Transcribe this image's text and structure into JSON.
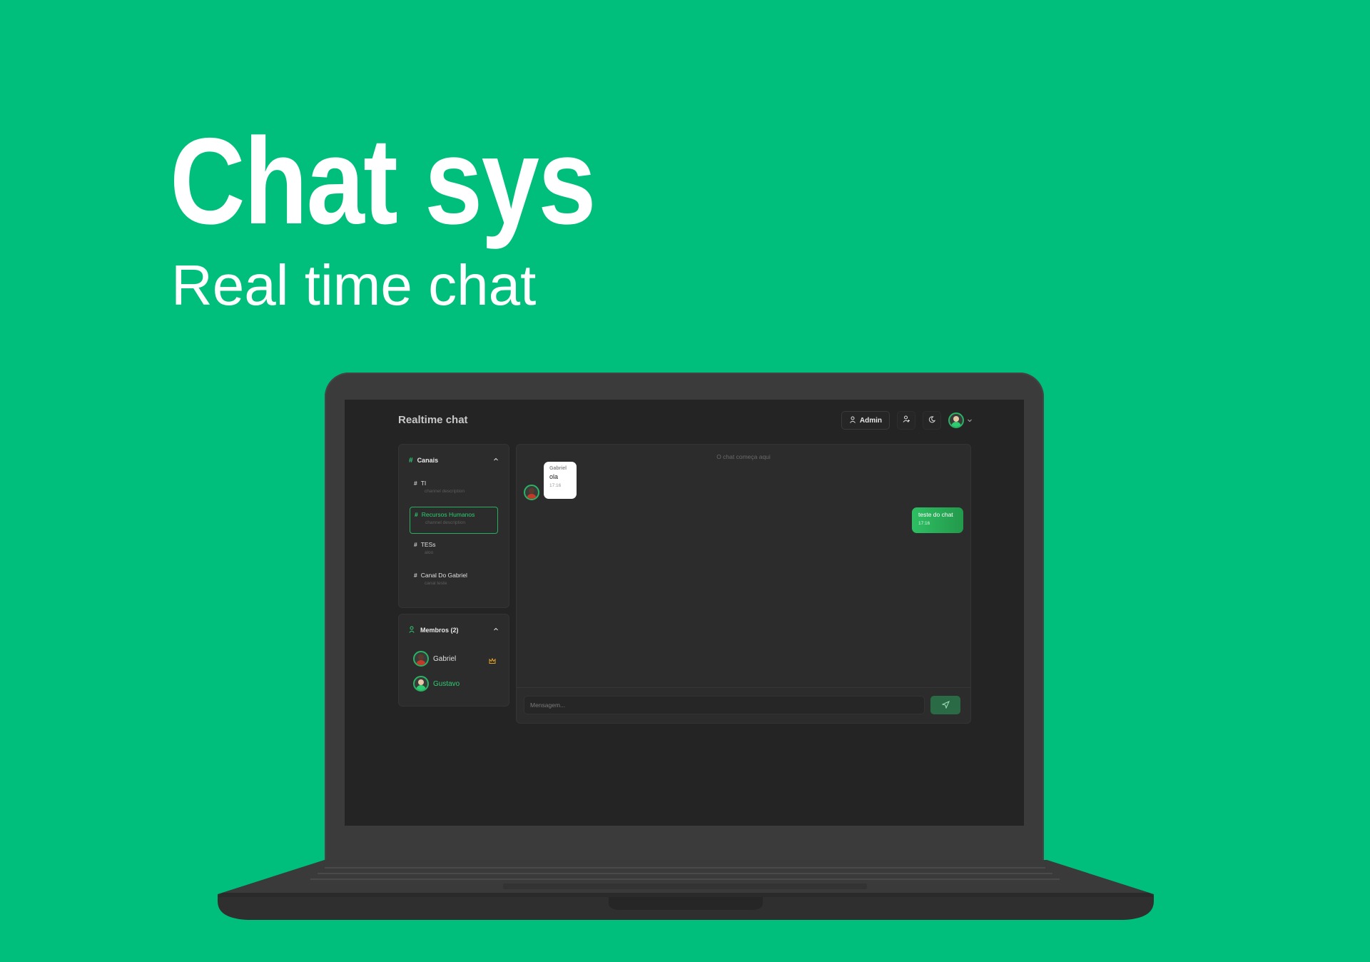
{
  "hero": {
    "title": "Chat sys",
    "subtitle": "Real time chat"
  },
  "app": {
    "title": "Realtime chat",
    "admin_label": "Admin",
    "colors": {
      "accent": "#2ecc71",
      "background": "#00bf7d",
      "screen": "#242424"
    }
  },
  "channels": {
    "header": "Canais",
    "items": [
      {
        "name": "TI",
        "description": "channel description",
        "active": false
      },
      {
        "name": "Recursos Humanos",
        "description": "channel description",
        "active": true
      },
      {
        "name": "TESs",
        "description": "aloo",
        "active": false
      },
      {
        "name": "Canal Do Gabriel",
        "description": "canal teste",
        "active": false
      }
    ]
  },
  "members": {
    "header": "Membros (2)",
    "items": [
      {
        "name": "Gabriel",
        "role_icon": "crown-icon"
      },
      {
        "name": "Gustavo"
      }
    ]
  },
  "chat": {
    "start_label": "O chat começa aqui",
    "messages": [
      {
        "sender": "Gabriel",
        "text": "ola",
        "time": "17:16",
        "direction": "incoming"
      },
      {
        "text": "teste do chat",
        "time": "17:16",
        "direction": "outgoing"
      }
    ],
    "input_placeholder": "Mensagem..."
  }
}
